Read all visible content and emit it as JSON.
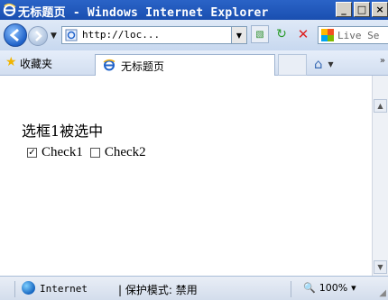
{
  "window": {
    "title": "无标题页 - Windows Internet Explorer",
    "controls": {
      "minimize": "_",
      "maximize": "□",
      "close": "×"
    }
  },
  "address_bar": {
    "url": "http://loc...",
    "search_placeholder": "Live Se"
  },
  "favorites": {
    "label": "收藏夹",
    "tab_title": "无标题页"
  },
  "page": {
    "heading": "选框1被选中",
    "checkboxes": [
      {
        "label": "Check1",
        "checked": true
      },
      {
        "label": "Check2",
        "checked": false
      }
    ]
  },
  "status": {
    "zone": "Internet",
    "protected_mode": "| 保护模式: 禁用",
    "zoom": "100%"
  },
  "icons": {
    "back": "back-arrow-icon",
    "forward": "forward-arrow-icon",
    "refresh": "refresh-icon",
    "stop": "stop-icon",
    "home": "home-icon",
    "favorites": "star-icon"
  }
}
